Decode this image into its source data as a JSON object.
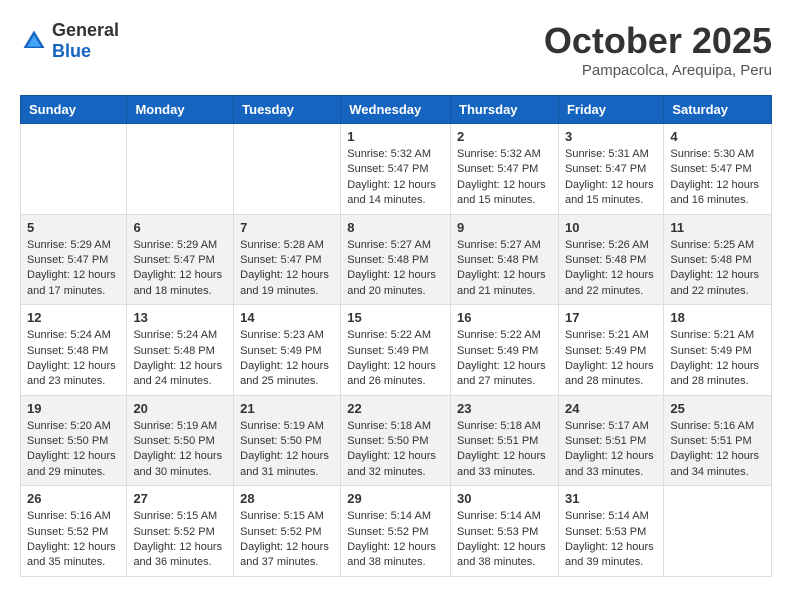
{
  "header": {
    "logo_general": "General",
    "logo_blue": "Blue",
    "month_title": "October 2025",
    "location": "Pampacolca, Arequipa, Peru"
  },
  "calendar": {
    "days_of_week": [
      "Sunday",
      "Monday",
      "Tuesday",
      "Wednesday",
      "Thursday",
      "Friday",
      "Saturday"
    ],
    "weeks": [
      [
        {
          "day": "",
          "info": ""
        },
        {
          "day": "",
          "info": ""
        },
        {
          "day": "",
          "info": ""
        },
        {
          "day": "1",
          "info": "Sunrise: 5:32 AM\nSunset: 5:47 PM\nDaylight: 12 hours and 14 minutes."
        },
        {
          "day": "2",
          "info": "Sunrise: 5:32 AM\nSunset: 5:47 PM\nDaylight: 12 hours and 15 minutes."
        },
        {
          "day": "3",
          "info": "Sunrise: 5:31 AM\nSunset: 5:47 PM\nDaylight: 12 hours and 15 minutes."
        },
        {
          "day": "4",
          "info": "Sunrise: 5:30 AM\nSunset: 5:47 PM\nDaylight: 12 hours and 16 minutes."
        }
      ],
      [
        {
          "day": "5",
          "info": "Sunrise: 5:29 AM\nSunset: 5:47 PM\nDaylight: 12 hours and 17 minutes."
        },
        {
          "day": "6",
          "info": "Sunrise: 5:29 AM\nSunset: 5:47 PM\nDaylight: 12 hours and 18 minutes."
        },
        {
          "day": "7",
          "info": "Sunrise: 5:28 AM\nSunset: 5:47 PM\nDaylight: 12 hours and 19 minutes."
        },
        {
          "day": "8",
          "info": "Sunrise: 5:27 AM\nSunset: 5:48 PM\nDaylight: 12 hours and 20 minutes."
        },
        {
          "day": "9",
          "info": "Sunrise: 5:27 AM\nSunset: 5:48 PM\nDaylight: 12 hours and 21 minutes."
        },
        {
          "day": "10",
          "info": "Sunrise: 5:26 AM\nSunset: 5:48 PM\nDaylight: 12 hours and 22 minutes."
        },
        {
          "day": "11",
          "info": "Sunrise: 5:25 AM\nSunset: 5:48 PM\nDaylight: 12 hours and 22 minutes."
        }
      ],
      [
        {
          "day": "12",
          "info": "Sunrise: 5:24 AM\nSunset: 5:48 PM\nDaylight: 12 hours and 23 minutes."
        },
        {
          "day": "13",
          "info": "Sunrise: 5:24 AM\nSunset: 5:48 PM\nDaylight: 12 hours and 24 minutes."
        },
        {
          "day": "14",
          "info": "Sunrise: 5:23 AM\nSunset: 5:49 PM\nDaylight: 12 hours and 25 minutes."
        },
        {
          "day": "15",
          "info": "Sunrise: 5:22 AM\nSunset: 5:49 PM\nDaylight: 12 hours and 26 minutes."
        },
        {
          "day": "16",
          "info": "Sunrise: 5:22 AM\nSunset: 5:49 PM\nDaylight: 12 hours and 27 minutes."
        },
        {
          "day": "17",
          "info": "Sunrise: 5:21 AM\nSunset: 5:49 PM\nDaylight: 12 hours and 28 minutes."
        },
        {
          "day": "18",
          "info": "Sunrise: 5:21 AM\nSunset: 5:49 PM\nDaylight: 12 hours and 28 minutes."
        }
      ],
      [
        {
          "day": "19",
          "info": "Sunrise: 5:20 AM\nSunset: 5:50 PM\nDaylight: 12 hours and 29 minutes."
        },
        {
          "day": "20",
          "info": "Sunrise: 5:19 AM\nSunset: 5:50 PM\nDaylight: 12 hours and 30 minutes."
        },
        {
          "day": "21",
          "info": "Sunrise: 5:19 AM\nSunset: 5:50 PM\nDaylight: 12 hours and 31 minutes."
        },
        {
          "day": "22",
          "info": "Sunrise: 5:18 AM\nSunset: 5:50 PM\nDaylight: 12 hours and 32 minutes."
        },
        {
          "day": "23",
          "info": "Sunrise: 5:18 AM\nSunset: 5:51 PM\nDaylight: 12 hours and 33 minutes."
        },
        {
          "day": "24",
          "info": "Sunrise: 5:17 AM\nSunset: 5:51 PM\nDaylight: 12 hours and 33 minutes."
        },
        {
          "day": "25",
          "info": "Sunrise: 5:16 AM\nSunset: 5:51 PM\nDaylight: 12 hours and 34 minutes."
        }
      ],
      [
        {
          "day": "26",
          "info": "Sunrise: 5:16 AM\nSunset: 5:52 PM\nDaylight: 12 hours and 35 minutes."
        },
        {
          "day": "27",
          "info": "Sunrise: 5:15 AM\nSunset: 5:52 PM\nDaylight: 12 hours and 36 minutes."
        },
        {
          "day": "28",
          "info": "Sunrise: 5:15 AM\nSunset: 5:52 PM\nDaylight: 12 hours and 37 minutes."
        },
        {
          "day": "29",
          "info": "Sunrise: 5:14 AM\nSunset: 5:52 PM\nDaylight: 12 hours and 38 minutes."
        },
        {
          "day": "30",
          "info": "Sunrise: 5:14 AM\nSunset: 5:53 PM\nDaylight: 12 hours and 38 minutes."
        },
        {
          "day": "31",
          "info": "Sunrise: 5:14 AM\nSunset: 5:53 PM\nDaylight: 12 hours and 39 minutes."
        },
        {
          "day": "",
          "info": ""
        }
      ]
    ]
  }
}
